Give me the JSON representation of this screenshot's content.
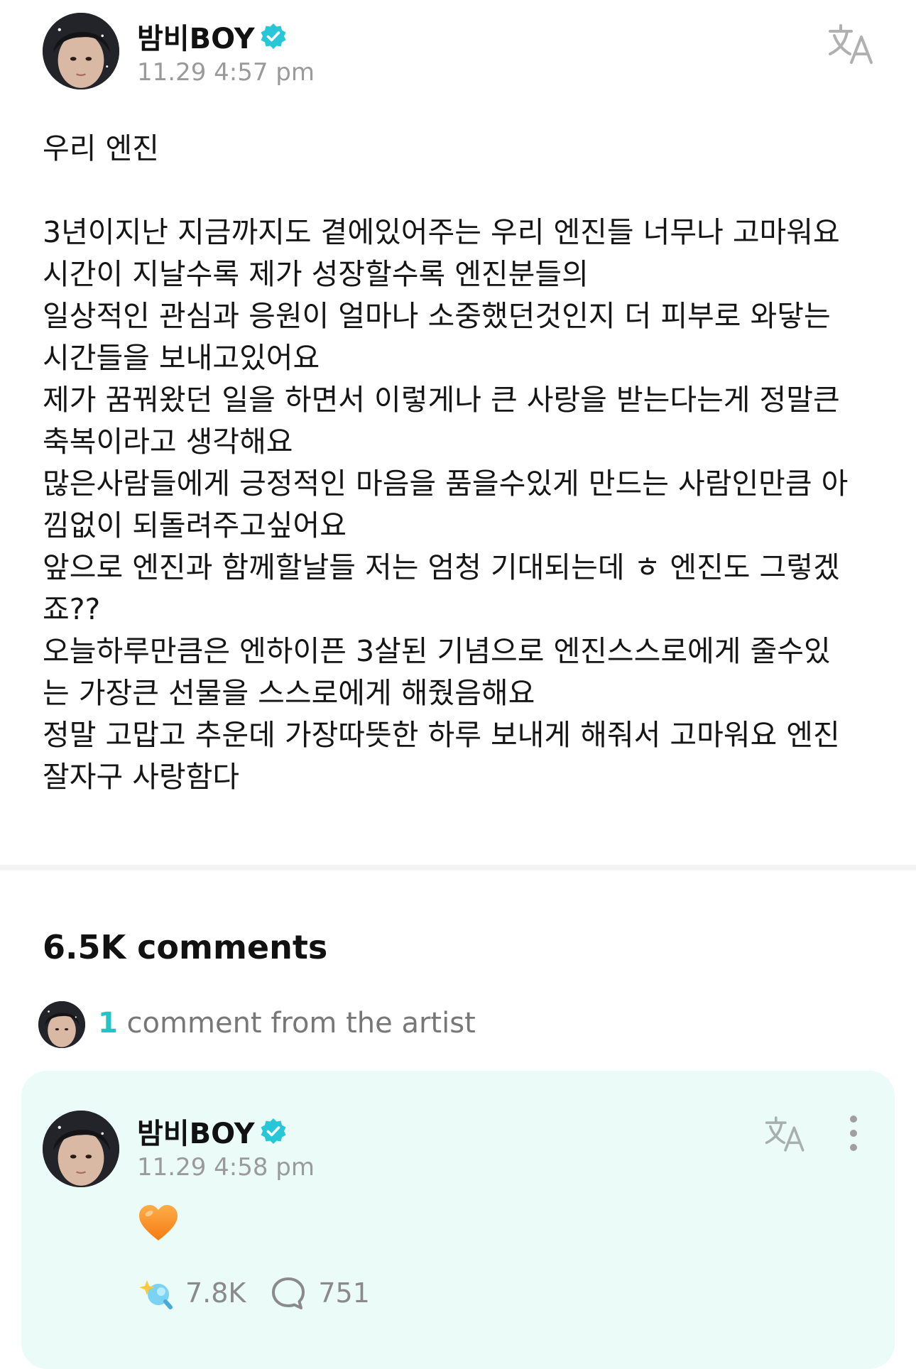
{
  "post": {
    "author": "밤비BOY",
    "verified": true,
    "timestamp": "11.29 4:57 pm",
    "title": "우리 엔진",
    "lines": [
      "3년이지난 지금까지도 곁에있어주는 우리 엔진들 너무나 고마워요",
      "시간이 지날수록 제가 성장할수록 엔진분들의",
      "일상적인 관심과 응원이 얼마나 소중했던것인지 더 피부로 와닿는",
      "시간들을 보내고있어요",
      "제가 꿈꿔왔던 일을 하면서 이렇게나 큰 사랑을 받는다는게 정말큰",
      "축복이라고 생각해요",
      "많은사람들에게 긍정적인 마음을 품을수있게 만드는 사람인만큼 아",
      "낌없이 되돌려주고싶어요",
      "앞으로 엔진과 함께할날들 저는 엄청 기대되는데 ㅎ 엔진도 그렇겠",
      "죠??",
      "오늘하루만큼은 엔하이픈 3살된 기념으로 엔진스스로에게 줄수있",
      "는 가장큰 선물을 스스로에게 해줬음해요",
      "정말 고맙고 추운데 가장따뜻한 하루 보내게 해줘서 고마워요 엔진",
      "잘자구 사랑함다"
    ]
  },
  "comments": {
    "count_label": "6.5K comments",
    "artist_summary": {
      "count": "1",
      "text": " comment from the artist"
    }
  },
  "artist_comment": {
    "author": "밤비BOY",
    "verified": true,
    "timestamp": "11.29 4:58 pm",
    "emoji": "orange-heart",
    "likes": "7.8K",
    "replies": "751"
  },
  "icons": {
    "verified": "verified-badge-icon",
    "translate": "translate-icon",
    "more": "more-vertical-icon",
    "like": "sparkle-like-icon",
    "reply": "speech-bubble-icon"
  },
  "colors": {
    "accent": "#22c4c4",
    "card_background": "#eafbf8",
    "verified_badge": "#27c7d8",
    "muted_text": "#9a9a9a",
    "heart": "#ff8a1e"
  }
}
